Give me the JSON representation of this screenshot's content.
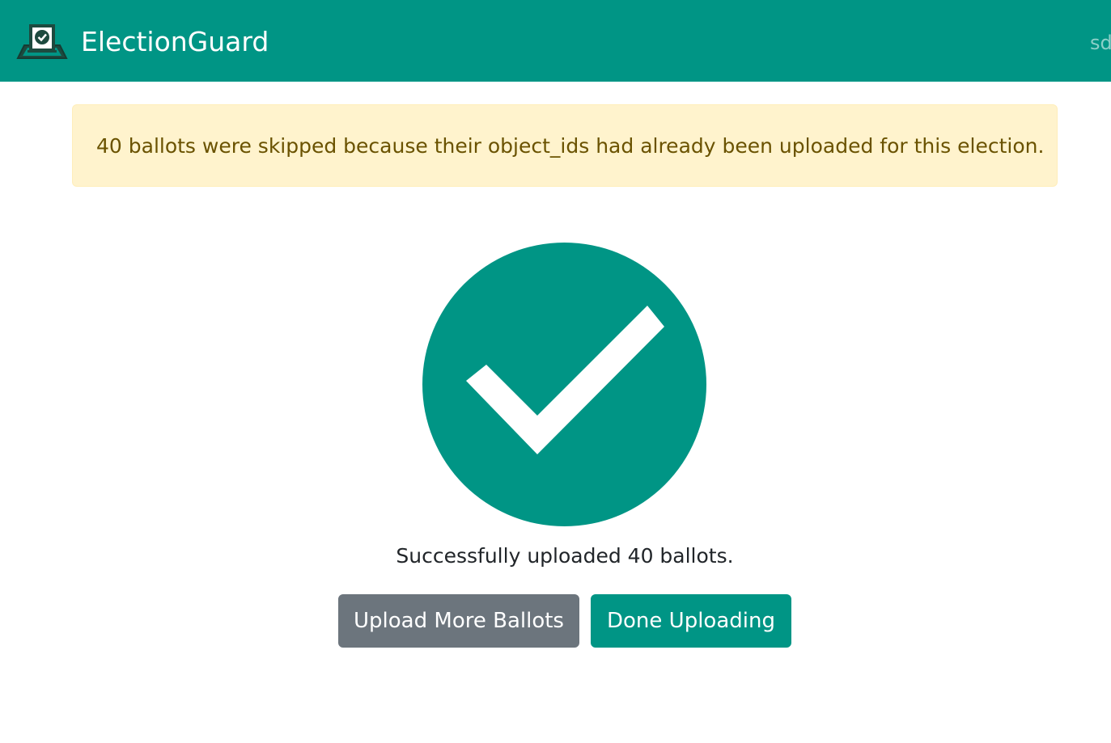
{
  "navbar": {
    "brand": "ElectionGuard",
    "user_text": "sd",
    "logo_icon": "ballot-box-icon"
  },
  "alert": {
    "message": "40 ballots were skipped because their object_ids had already been uploaded for this election."
  },
  "status": {
    "icon": "check-circle-icon",
    "message": "Successfully uploaded 40 ballots."
  },
  "actions": {
    "upload_more_label": "Upload More Ballots",
    "done_label": "Done Uploading"
  },
  "colors": {
    "primary": "#009585",
    "secondary": "#6c757d",
    "alert_bg": "#fff3cd",
    "alert_text": "#6a5200"
  }
}
